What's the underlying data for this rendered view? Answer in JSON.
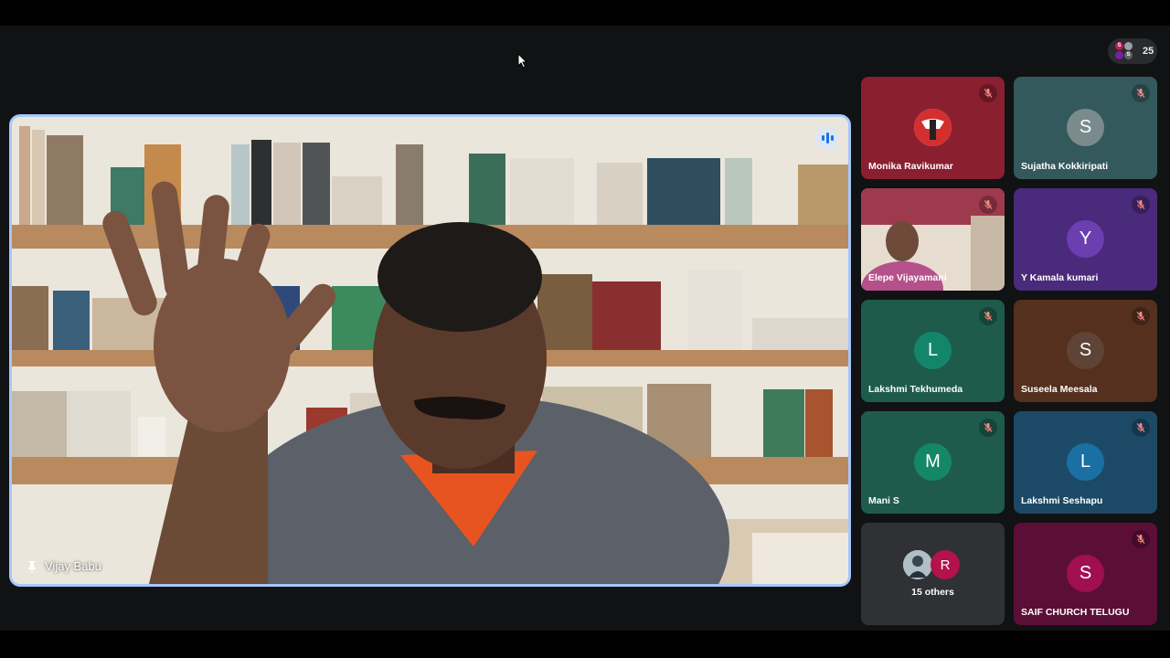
{
  "participants_count": "25",
  "count_avatar_letters": [
    "S",
    "",
    "",
    "S"
  ],
  "main_speaker": {
    "name": "Vijay Babu"
  },
  "tiles": [
    {
      "name": "Monika Ravikumar",
      "initial": "",
      "bg": "#8a1f30",
      "muted": true,
      "kind": "photo-avatar"
    },
    {
      "name": "Sujatha Kokkiripati",
      "initial": "S",
      "bg": "#34595c",
      "avatar_bg": "#7b8a8c",
      "muted": true,
      "kind": "letter"
    },
    {
      "name": "Elepe Vijayamani",
      "initial": "",
      "bg": "#b15a6a",
      "muted": true,
      "kind": "video"
    },
    {
      "name": "Y Kamala kumari",
      "initial": "Y",
      "bg": "#4a2a7a",
      "avatar_bg": "#6b3fb0",
      "muted": true,
      "kind": "letter"
    },
    {
      "name": "Lakshmi Tekhumeda",
      "initial": "L",
      "bg": "#1e5b4b",
      "avatar_bg": "#13856a",
      "muted": true,
      "kind": "letter"
    },
    {
      "name": "Suseela Meesala",
      "initial": "S",
      "bg": "#55301f",
      "avatar_bg": "#5e4336",
      "muted": true,
      "kind": "letter"
    },
    {
      "name": "Mani S",
      "initial": "M",
      "bg": "#1f5b4c",
      "avatar_bg": "#148866",
      "muted": true,
      "kind": "letter"
    },
    {
      "name": "Lakshmi Seshapu",
      "initial": "L",
      "bg": "#1c4a66",
      "avatar_bg": "#1a6fa3",
      "muted": true,
      "kind": "letter"
    },
    {
      "name": "15 others",
      "initial": "R",
      "bg": "#303134",
      "avatar_bg": "#b3124a",
      "muted": false,
      "kind": "others"
    },
    {
      "name": "SAIF CHURCH TELUGU",
      "initial": "S",
      "bg": "#5b0f36",
      "avatar_bg": "#a01051",
      "muted": true,
      "kind": "letter"
    }
  ],
  "icons": {
    "mute": "mic-off-icon",
    "pin": "pin-icon",
    "speaking": "audio-level-icon",
    "cursor": "cursor-icon"
  }
}
